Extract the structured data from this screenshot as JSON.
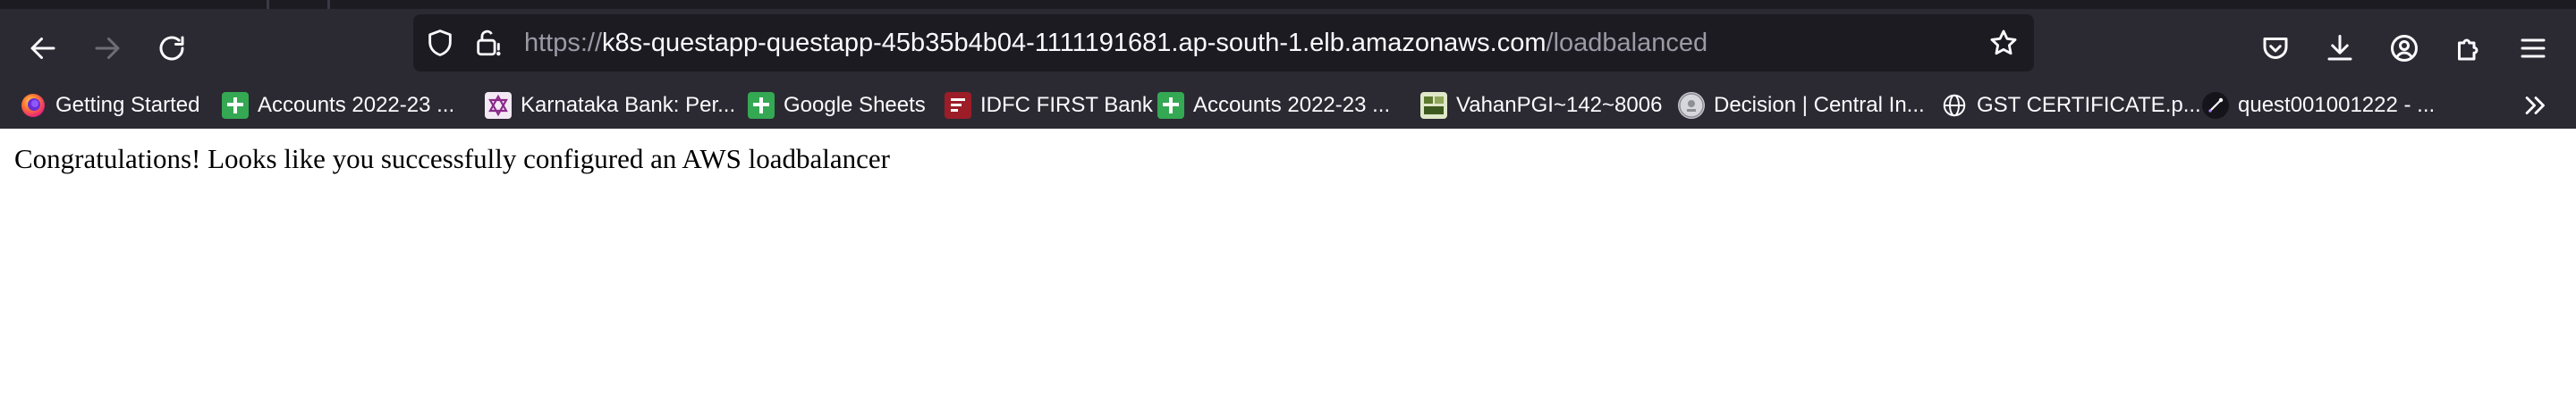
{
  "browser": {
    "url": {
      "scheme": "https://",
      "host": "k8s-questapp-questapp-45b35b4b04-1111191681.ap-south-1.elb.amazonaws.com",
      "path": "/loadbalanced"
    },
    "nav_icons": [
      "back-arrow-icon",
      "forward-arrow-icon",
      "reload-icon"
    ],
    "url_icons": [
      "shield-icon",
      "insecure-lock-icon",
      "star-icon"
    ],
    "toolbar_icons": [
      "pocket-icon",
      "download-icon",
      "account-icon",
      "extensions-icon",
      "menu-icon"
    ],
    "colors": {
      "chrome": "#2b2a33",
      "urlbar": "#1c1b22",
      "url_text": "#fbfbfe",
      "url_dim": "#9b9aa5",
      "sheets_green": "#34a853",
      "idfc_red": "#9c1d27"
    }
  },
  "bookmarks": [
    {
      "label": "Getting Started",
      "icon": "firefox-icon"
    },
    {
      "label": "Accounts 2022-23 ...",
      "icon": "google-sheets-icon"
    },
    {
      "label": "Karnataka Bank: Per...",
      "icon": "karnataka-bank-icon"
    },
    {
      "label": "Google Sheets",
      "icon": "google-sheets-icon"
    },
    {
      "label": "IDFC FIRST Bank",
      "icon": "idfc-icon"
    },
    {
      "label": "Accounts 2022-23 ...",
      "icon": "google-sheets-icon"
    },
    {
      "label": "VahanPGI~142~8006",
      "icon": "vahan-icon"
    },
    {
      "label": "Decision | Central In...",
      "icon": "emblem-icon"
    },
    {
      "label": "GST CERTIFICATE.p...",
      "icon": "globe-icon"
    },
    {
      "label": "quest001001222 - ...",
      "icon": "quest-icon"
    }
  ],
  "overflow_icon": "chevron-double-right-icon",
  "page": {
    "message": "Congratulations! Looks like you successfully configured an AWS loadbalancer"
  }
}
